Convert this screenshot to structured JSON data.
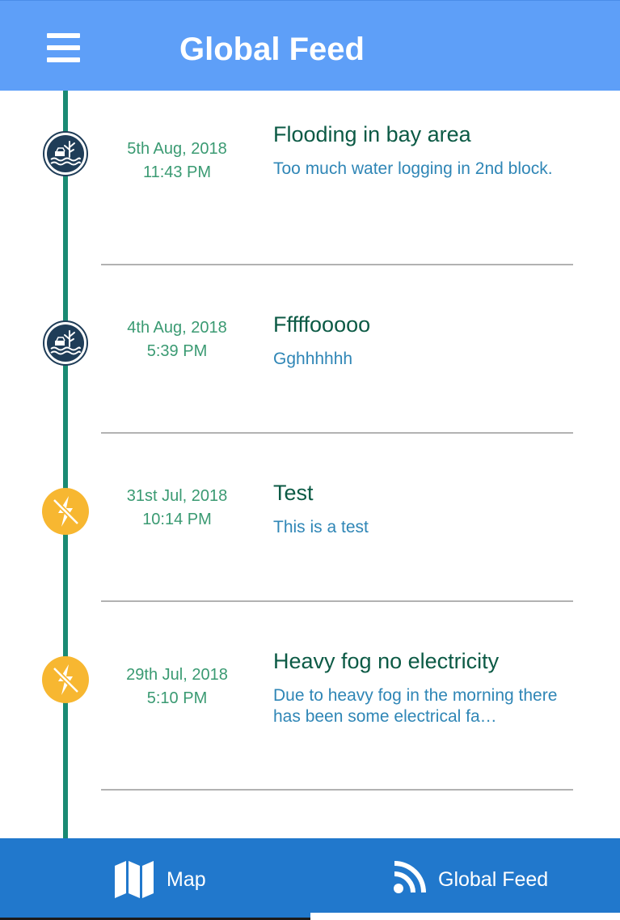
{
  "header": {
    "title": "Global Feed",
    "menu_icon": "hamburger-menu-icon",
    "background_color": "#5e9ff8"
  },
  "feed": {
    "timeline_color": "#1a8a73",
    "items": [
      {
        "category_icon": "flood-icon",
        "date": "5th Aug, 2018",
        "time": "11:43 PM",
        "title": "Flooding in bay area",
        "description": "Too much water logging in 2nd block."
      },
      {
        "category_icon": "flood-icon",
        "date": "4th Aug, 2018",
        "time": "5:39 PM",
        "title": "Fffffooooo",
        "description": "Gghhhhhh"
      },
      {
        "category_icon": "no-electricity-icon",
        "date": "31st Jul, 2018",
        "time": "10:14 PM",
        "title": "Test",
        "description": "This is a test"
      },
      {
        "category_icon": "no-electricity-icon",
        "date": "29th Jul, 2018",
        "time": "5:10 PM",
        "title": "Heavy fog no electricity",
        "description": "Due to heavy fog in the morning there has been some electrical fa…"
      }
    ]
  },
  "bottom_nav": {
    "background_color": "#2178cc",
    "tabs": [
      {
        "label": "Map",
        "icon": "map-icon",
        "active": false
      },
      {
        "label": "Global Feed",
        "icon": "rss-feed-icon",
        "active": true
      }
    ]
  }
}
